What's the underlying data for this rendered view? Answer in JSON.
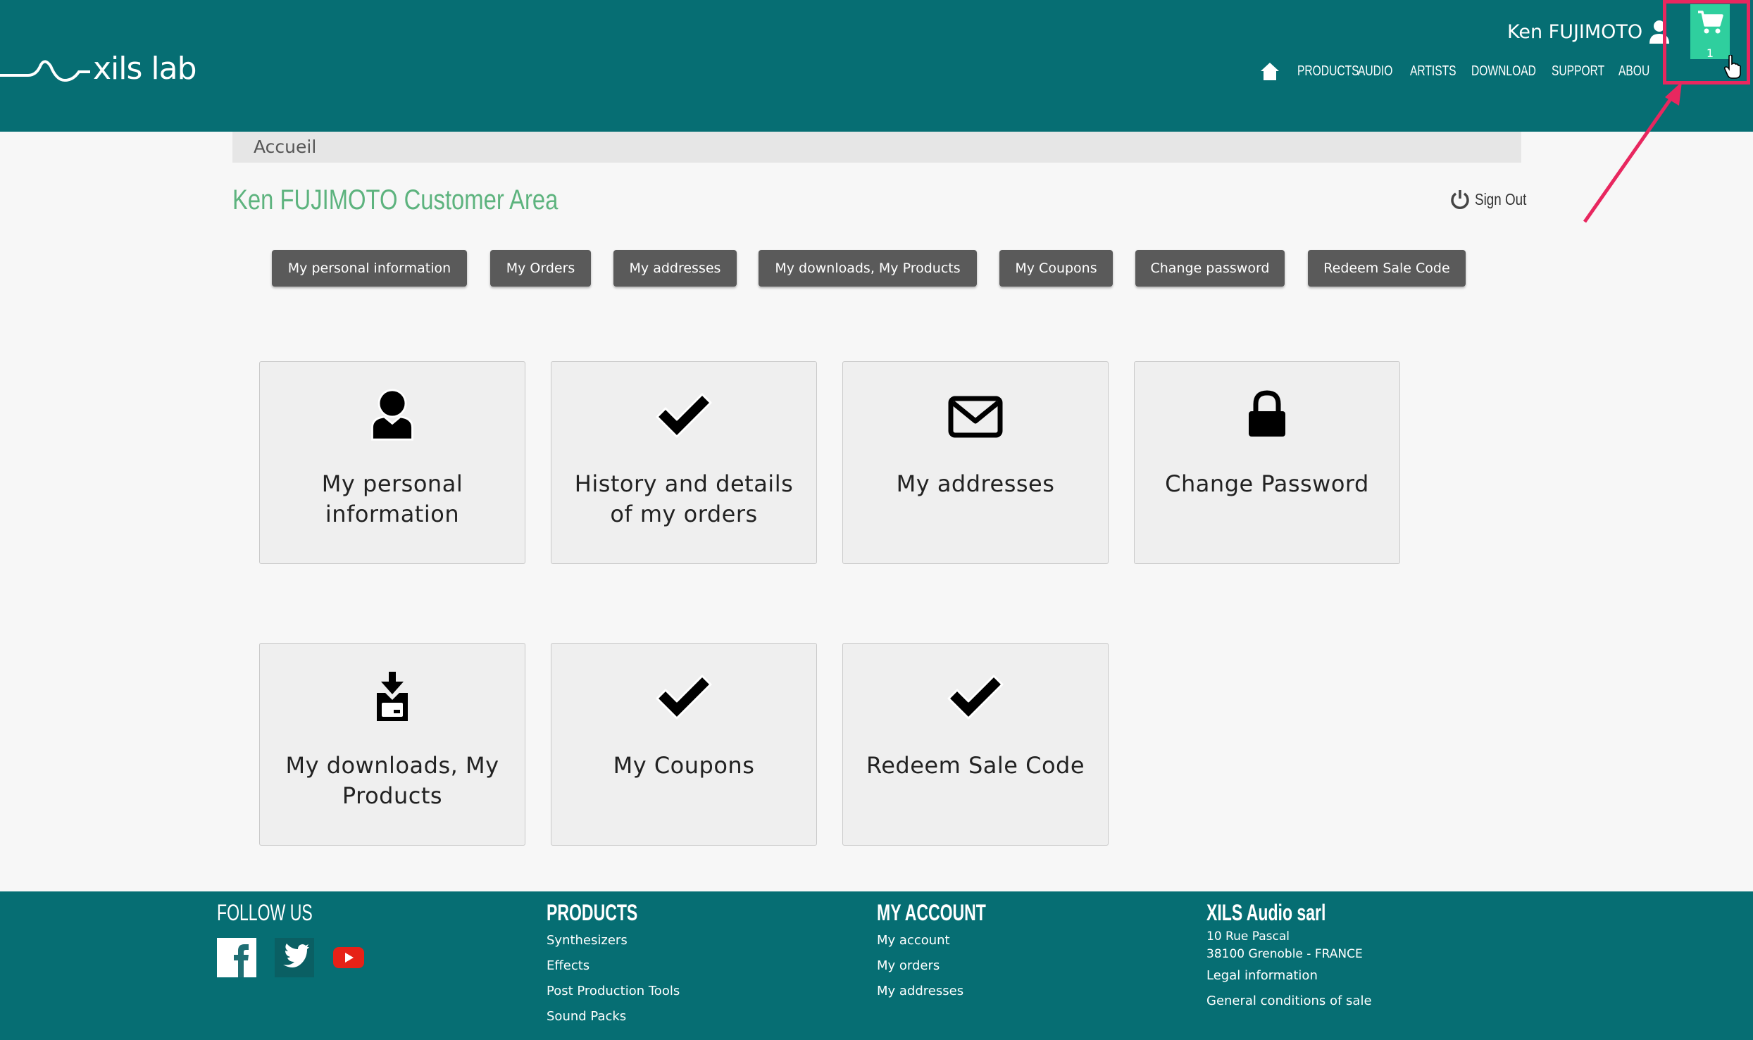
{
  "header": {
    "user_name": "Ken FUJIMOTO",
    "nav": [
      "PRODUCTS",
      "AUDIO",
      "ARTISTS",
      "DOWNLOAD",
      "SUPPORT",
      "ABOU"
    ],
    "cart_count": "1",
    "icons": {
      "home": "home-icon",
      "user": "user-icon",
      "cart": "shopping-cart-icon"
    }
  },
  "breadcrumb": "Accueil",
  "page_title": "Ken FUJIMOTO Customer Area",
  "signout_label": "Sign Out",
  "tabs": [
    "My personal information",
    "My Orders",
    "My addresses",
    "My downloads, My Products",
    "My Coupons",
    "Change password",
    "Redeem Sale Code"
  ],
  "tiles": [
    {
      "label": "My personal information",
      "icon": "person-icon"
    },
    {
      "label": "History and details of my orders",
      "icon": "checkmark-icon"
    },
    {
      "label": "My addresses",
      "icon": "envelope-icon"
    },
    {
      "label": "Change Password",
      "icon": "lock-icon"
    },
    {
      "label": "My downloads, My Products",
      "icon": "download-icon"
    },
    {
      "label": "My Coupons",
      "icon": "checkmark-icon"
    },
    {
      "label": "Redeem Sale Code",
      "icon": "checkmark-icon"
    }
  ],
  "footer": {
    "follow_us": "FOLLOW US",
    "products": {
      "title": "PRODUCTS",
      "links": [
        "Synthesizers",
        "Effects",
        "Post Production Tools",
        "Sound Packs"
      ]
    },
    "account": {
      "title": "MY ACCOUNT",
      "links": [
        "My account",
        "My orders",
        "My addresses"
      ]
    },
    "company": {
      "title": "XILS Audio sarl",
      "address": [
        "10 Rue Pascal",
        "38100 Grenoble - FRANCE"
      ],
      "links": [
        "Legal information",
        "General conditions of sale"
      ]
    }
  },
  "colors": {
    "header_bg": "#066e73",
    "title_green": "#5db37e",
    "cart_bg": "#2fcf9e",
    "highlight": "#e8275f",
    "button_bg": "#5a5a5a"
  }
}
